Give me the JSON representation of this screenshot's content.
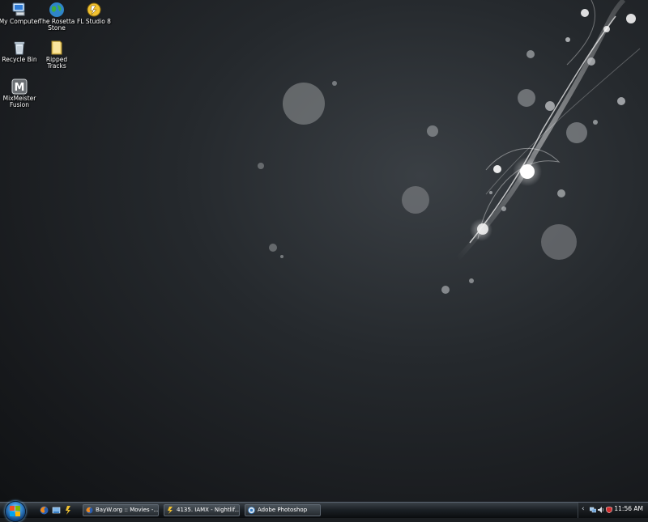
{
  "desktop": {
    "icons": [
      {
        "label": "My Computer",
        "icon": "computer-icon"
      },
      {
        "label": "The Rosetta Stone",
        "icon": "rosetta-stone-icon"
      },
      {
        "label": "FL Studio 8",
        "icon": "fl-studio-icon"
      },
      {
        "label": "Recycle Bin",
        "icon": "recycle-bin-icon"
      },
      {
        "label": "Ripped Tracks",
        "icon": "folder-icon"
      },
      {
        "label": "MixMeister Fusion",
        "icon": "mixmeister-icon"
      }
    ]
  },
  "taskbar": {
    "quick_launch": [
      "firefox-icon",
      "show-desktop-icon",
      "fl-studio-icon"
    ],
    "tasks": [
      {
        "label": "BayW.org :: Movies -...",
        "icon": "firefox-icon"
      },
      {
        "label": "4135. IAMX - Nightlif...",
        "icon": "fl-studio-icon"
      },
      {
        "label": "Adobe Photoshop",
        "icon": "photoshop-icon"
      }
    ],
    "tray": {
      "chevron": "‹",
      "icons": [
        "network-icon",
        "volume-icon",
        "security-icon"
      ],
      "clock": "11:56 AM"
    }
  },
  "colors": {
    "taskbar_top": "#3a4148",
    "taskbar_bottom": "#0a0c0e",
    "wallpaper_dark": "#17191c",
    "start_orb": "#3a8fd8"
  }
}
